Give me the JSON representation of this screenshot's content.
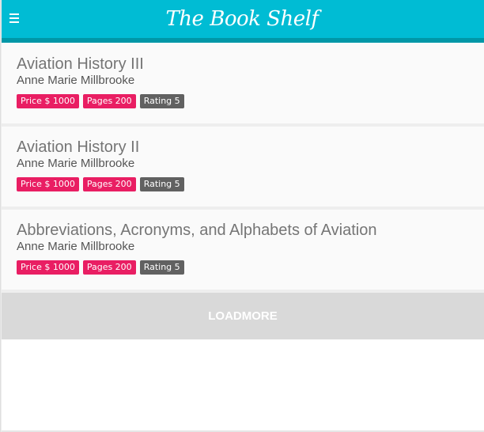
{
  "app_bar": {
    "title": "The Book Shelf",
    "menu_icon": "hamburger-menu-icon",
    "background_color": "#00bcd4",
    "border_color": "#0097a7"
  },
  "books": [
    {
      "title": "Aviation History III",
      "author": "Anne Marie Millbrooke",
      "price": "Price $ 1000",
      "pages": "Pages 200",
      "rating": "Rating 5"
    },
    {
      "title": "Aviation History II",
      "author": "Anne Marie Millbrooke",
      "price": "Price $ 1000",
      "pages": "Pages 200",
      "rating": "Rating 5"
    },
    {
      "title": "Abbreviations, Acronyms, and Alphabets of Aviation",
      "author": "Anne Marie Millbrooke",
      "price": "Price $ 1000",
      "pages": "Pages 200",
      "rating": "Rating 5"
    }
  ],
  "load_more": {
    "label": "LOADMORE"
  },
  "colors": {
    "badge_accent": "#e91e63",
    "badge_neutral": "#616161"
  }
}
